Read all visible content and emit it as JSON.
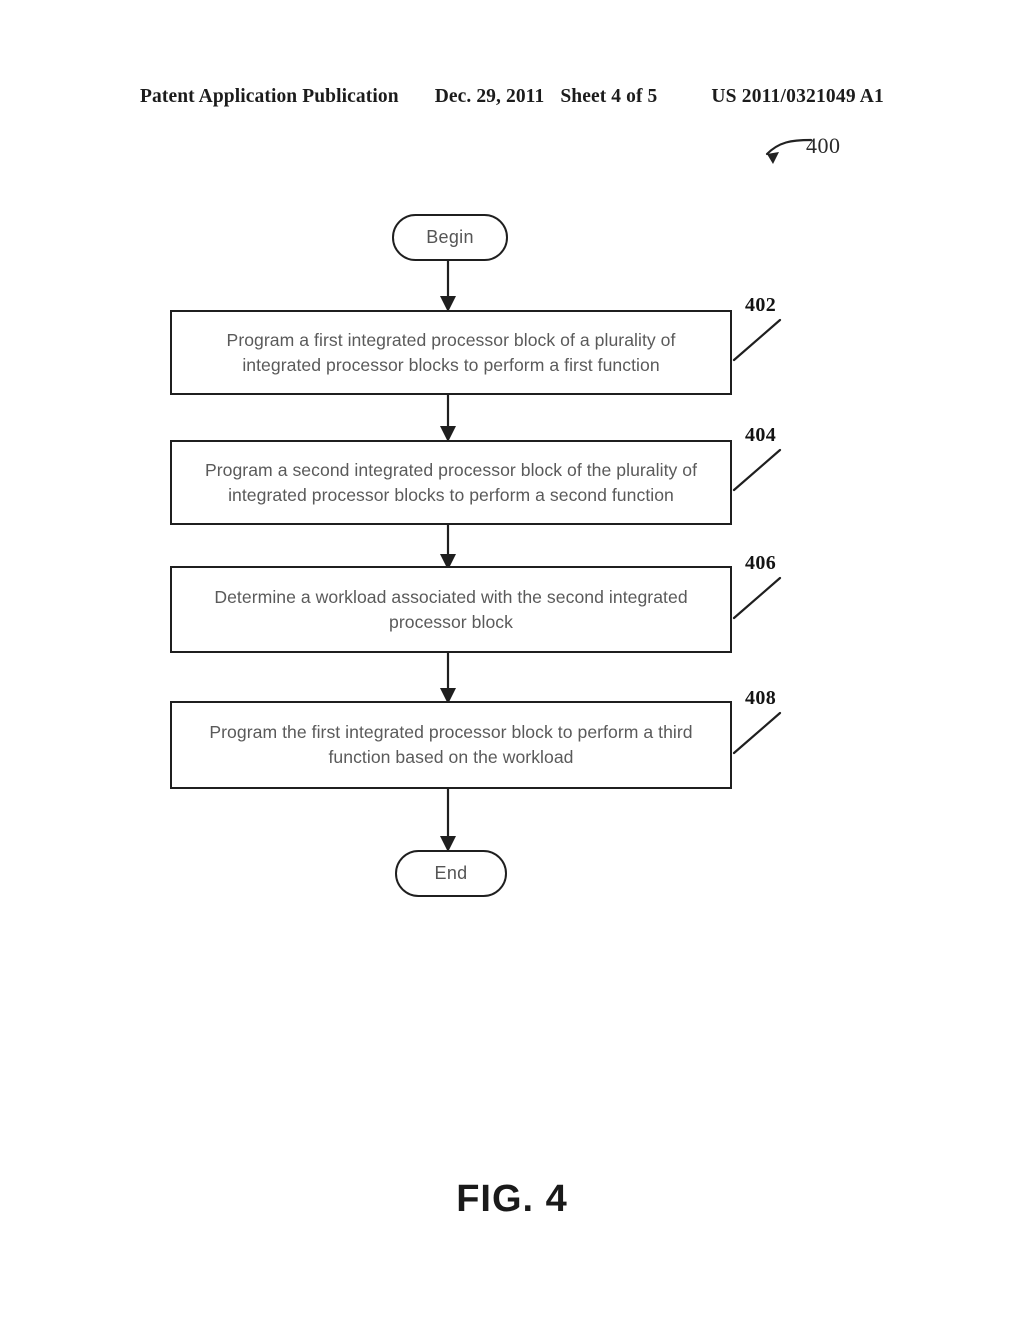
{
  "header": {
    "publication": "Patent Application Publication",
    "date": "Dec. 29, 2011",
    "sheet": "Sheet 4 of 5",
    "patent_number": "US 2011/0321049 A1"
  },
  "figure": {
    "callout_number": "400",
    "caption": "FIG. 4"
  },
  "flowchart": {
    "begin_label": "Begin",
    "end_label": "End",
    "steps": [
      {
        "ref": "402",
        "text": "Program a first integrated processor block of a plurality of integrated processor blocks to perform a first function"
      },
      {
        "ref": "404",
        "text": "Program a second integrated processor block of the plurality of integrated processor blocks to perform a second function"
      },
      {
        "ref": "406",
        "text": "Determine a workload associated with the second integrated processor block"
      },
      {
        "ref": "408",
        "text": "Program the first integrated processor block to perform a third function based on the workload"
      }
    ]
  },
  "colors": {
    "ink": "#1f1f1f",
    "text_gray": "#5a5a5a",
    "page_background": "#ffffff"
  }
}
